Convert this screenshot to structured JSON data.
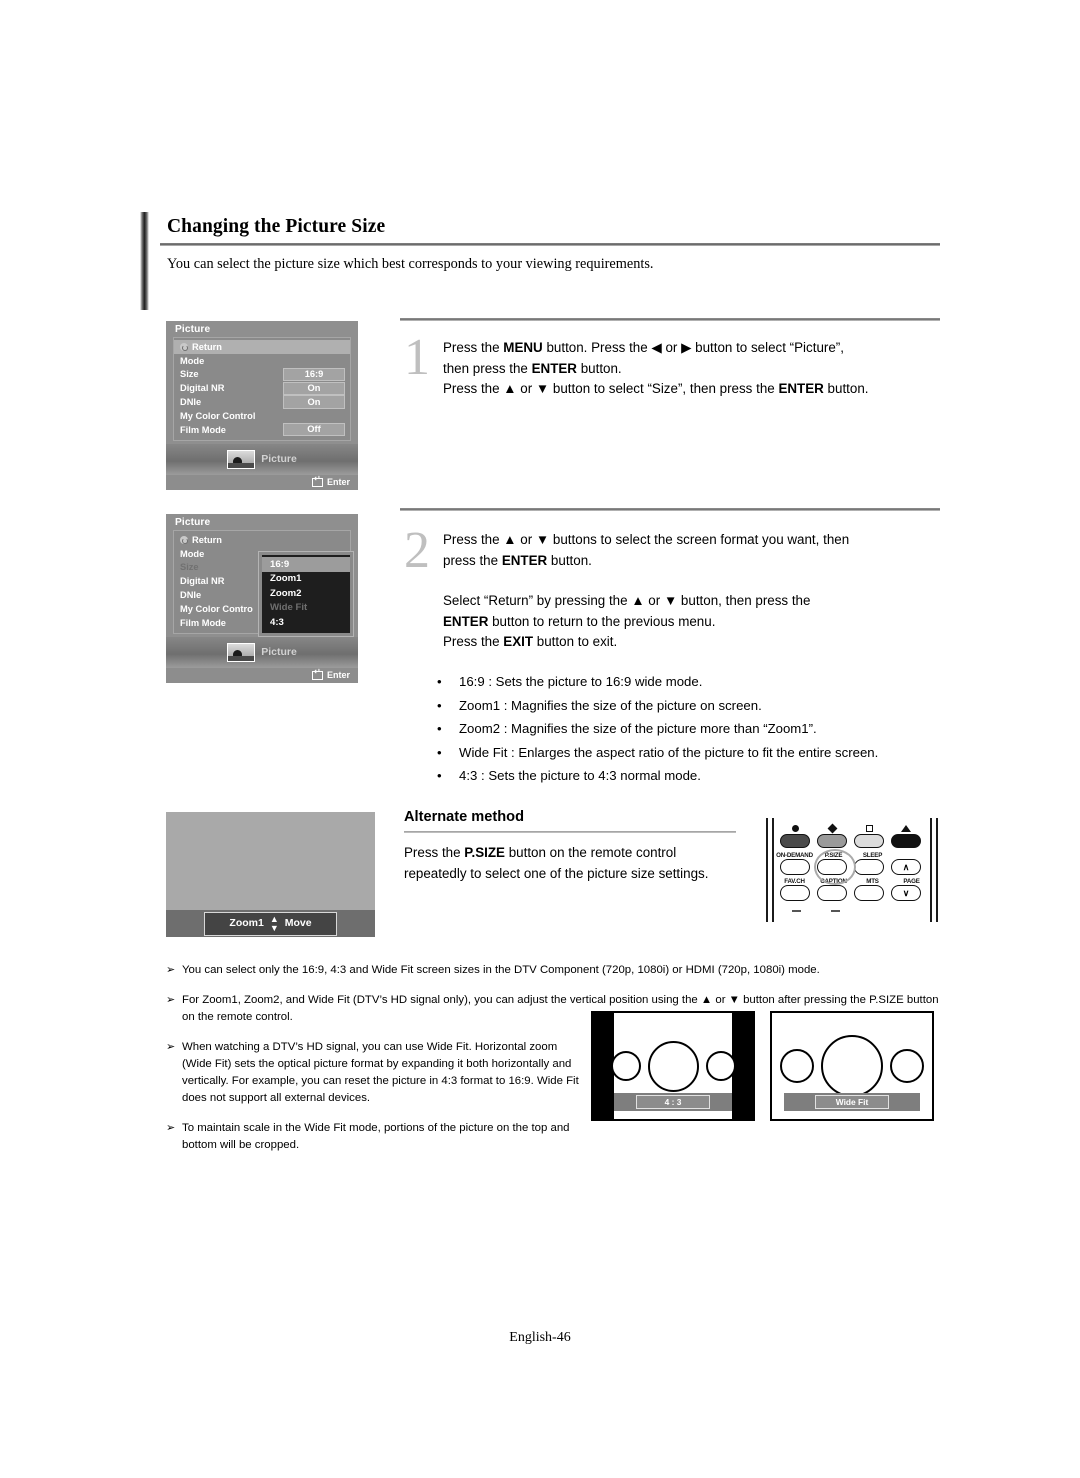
{
  "heading": "Changing the Picture Size",
  "intro": "You can select the picture size which best corresponds to your viewing requirements.",
  "steps": [
    {
      "number": "1",
      "line1_a": "Press the ",
      "line1_menu": "MENU",
      "line1_b": " button. Press the ",
      "left_arrow": "◀",
      "line1_c": " or ",
      "right_arrow": "▶",
      "line1_d": " button to select “Picture”,",
      "line2_a": "then press the ",
      "line2_enter": "ENTER",
      "line2_b": " button.",
      "line3_a": "Press the ",
      "up_arrow": "▲",
      "line3_b": " or ",
      "down_arrow": "▼",
      "line3_c": " button to select “Size”, then press the ",
      "line3_enter": "ENTER",
      "line3_d": " button."
    },
    {
      "number": "2",
      "line1_a": "Press the ",
      "up_arrow": "▲",
      "line1_b": " or ",
      "down_arrow": "▼",
      "line1_c": " buttons to select the screen format you want, then",
      "line2_a": "press the ",
      "line2_enter": "ENTER",
      "line2_b": " button.",
      "line3_a": "Select “Return” by pressing the ",
      "line3_b": " or ",
      "line3_c": " button, then press the",
      "line4_enter": "ENTER",
      "line4_b": " button to return to the previous menu.",
      "line5_a": "Press the ",
      "line5_exit": "EXIT",
      "line5_b": " button to exit."
    }
  ],
  "bullets": [
    {
      "dot": "•",
      "text": "16:9 : Sets the picture to 16:9 wide mode."
    },
    {
      "dot": "•",
      "text": "Zoom1 : Magnifies the size of the picture on screen."
    },
    {
      "dot": "•",
      "text": "Zoom2 : Magnifies the size of the picture more than “Zoom1”."
    },
    {
      "dot": "•",
      "text": "Wide Fit : Enlarges the aspect ratio of the picture to fit the entire screen."
    },
    {
      "dot": "•",
      "text": "4:3 : Sets the picture to 4:3 normal mode."
    }
  ],
  "alternate": {
    "title": "Alternate method",
    "body_a": "Press the ",
    "body_psize": "P.SIZE",
    "body_b": " button on the remote control",
    "body_c": "repeatedly to select one of the picture size settings."
  },
  "tv_preview": {
    "mode_label": "Zoom1",
    "move_label": "Move"
  },
  "remote": {
    "top_labels": [
      "ON-DEMAND",
      "P.SIZE",
      "SLEEP"
    ],
    "bottom_labels": [
      "FAV.CH",
      "CAPTION",
      "MTS",
      "PAGE"
    ],
    "page_up": "∧",
    "page_down": "∨",
    "highlighted_button": "P.SIZE"
  },
  "osd_menu_1": {
    "title": "Picture",
    "rows": [
      {
        "label": "Return",
        "value": "",
        "selected": true,
        "dim": false,
        "icon": "return-icon"
      },
      {
        "label": "Mode",
        "value": "",
        "selected": false,
        "dim": false
      },
      {
        "label": "Size",
        "value": "16:9",
        "selected": false,
        "dim": false
      },
      {
        "label": "Digital NR",
        "value": "On",
        "selected": false,
        "dim": false
      },
      {
        "label": "DNIe",
        "value": "On",
        "selected": false,
        "dim": false
      },
      {
        "label": "My Color Control",
        "value": "",
        "selected": false,
        "dim": false
      },
      {
        "label": "Film Mode",
        "value": "Off",
        "selected": false,
        "dim": false
      }
    ],
    "footer_label": "Picture",
    "enter_label": "Enter"
  },
  "osd_menu_2": {
    "title": "Picture",
    "rows": [
      {
        "label": "Return",
        "value": "",
        "selected": false,
        "dim": false,
        "icon": "return-icon"
      },
      {
        "label": "Mode",
        "value": "",
        "selected": false,
        "dim": false
      },
      {
        "label": "Size",
        "value": "",
        "selected": false,
        "dim": true
      },
      {
        "label": "Digital NR",
        "value": "",
        "selected": false,
        "dim": false
      },
      {
        "label": "DNIe",
        "value": "",
        "selected": false,
        "dim": false
      },
      {
        "label": "My Color Contro",
        "value": "",
        "selected": false,
        "dim": false
      },
      {
        "label": "Film Mode",
        "value": "",
        "selected": false,
        "dim": false
      }
    ],
    "dropdown": [
      {
        "label": "16:9",
        "selected": true,
        "dim": false
      },
      {
        "label": "Zoom1",
        "selected": false,
        "dim": false
      },
      {
        "label": "Zoom2",
        "selected": false,
        "dim": false
      },
      {
        "label": "Wide Fit",
        "selected": false,
        "dim": true
      },
      {
        "label": "4:3",
        "selected": false,
        "dim": false
      }
    ],
    "footer_label": "Picture",
    "enter_label": "Enter"
  },
  "notes": [
    {
      "arrow": "➢",
      "text": "You can select only the 16:9, 4:3 and Wide Fit screen sizes in the DTV Component (720p, 1080i) or HDMI (720p, 1080i) mode."
    },
    {
      "arrow": "➢",
      "text": "For Zoom1, Zoom2, and Wide Fit (DTV’s HD signal only), you can adjust the vertical position using the ▲ or ▼ button after pressing the P.SIZE button on the remote control."
    },
    {
      "arrow": "➢",
      "text": "When watching a DTV’s HD signal, you can use Wide Fit. Horizontal zoom (Wide Fit) sets the optical picture format by expanding it both horizontally and vertically. For example, you can reset the picture in 4:3 format to 16:9. Wide Fit does not support all external devices."
    },
    {
      "arrow": "➢",
      "text": "To maintain scale in the Wide Fit mode, portions of the picture on the top and bottom will be cropped."
    }
  ],
  "diagrams": [
    {
      "label": "4 : 3",
      "pillarbox": true
    },
    {
      "label": "Wide Fit",
      "pillarbox": false
    }
  ],
  "footer": "English-46",
  "colors": {
    "osd_background": "#8f8f8f",
    "osd_selected": "#b0b0b0",
    "dropdown_background": "#1e1e1e",
    "rule": "#6a6a6a"
  }
}
